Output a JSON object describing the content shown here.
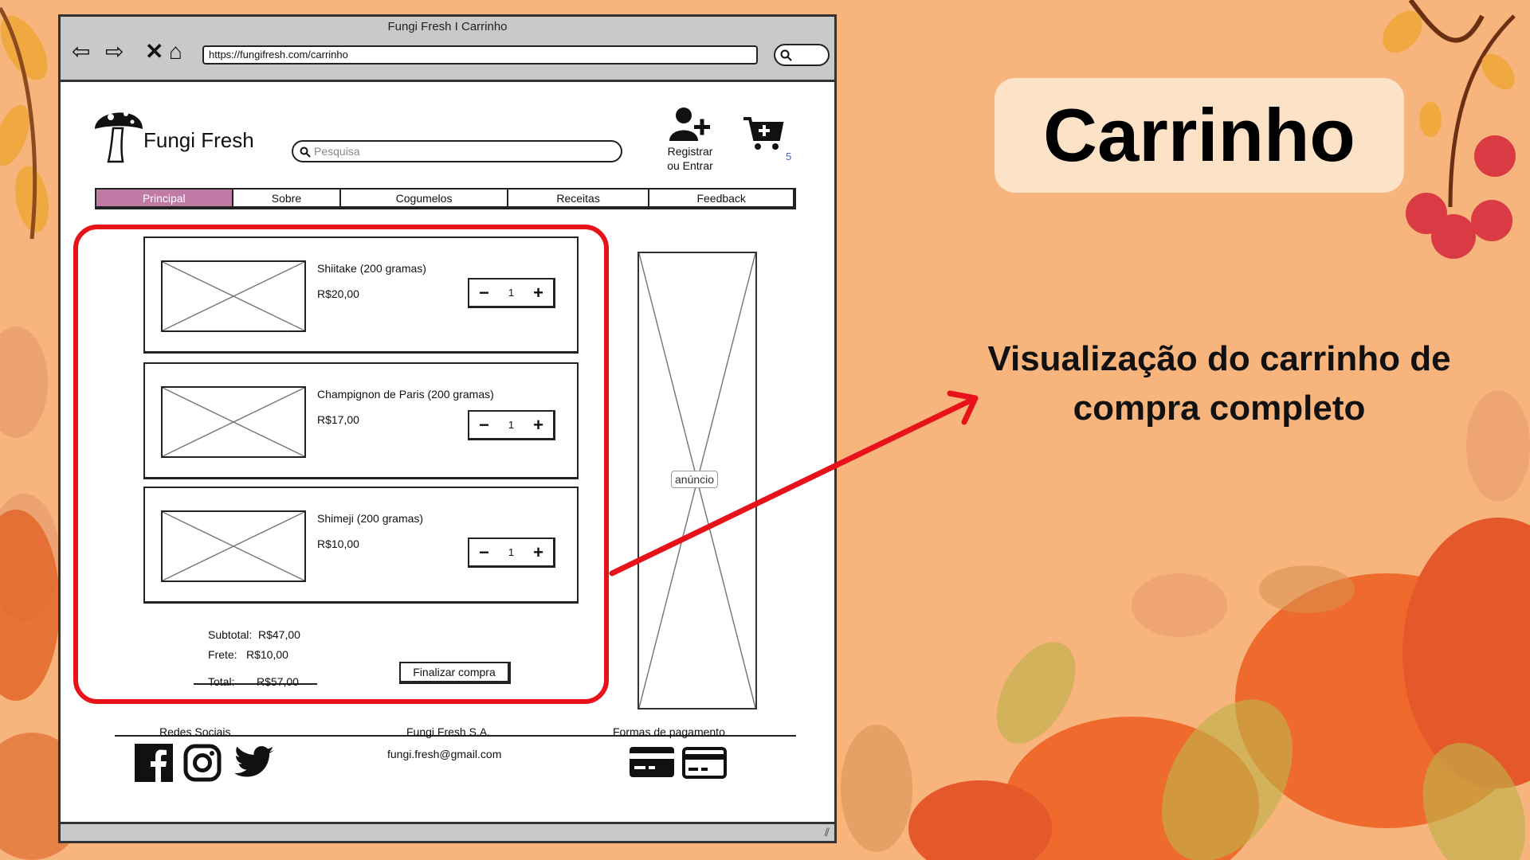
{
  "slide": {
    "title": "Carrinho",
    "description": "Visualização do carrinho de compra completo"
  },
  "browser": {
    "window_title": "Fungi Fresh I Carrinho",
    "url": "https://fungifresh.com/carrinho"
  },
  "header": {
    "brand": "Fungi Fresh",
    "search_placeholder": "Pesquisa",
    "account_label_1": "Registrar",
    "account_label_2": "ou Entrar",
    "cart_count": "5"
  },
  "nav": {
    "tabs": [
      {
        "label": "Principal",
        "active": true
      },
      {
        "label": "Sobre"
      },
      {
        "label": "Cogumelos"
      },
      {
        "label": "Receitas"
      },
      {
        "label": "Feedback"
      }
    ]
  },
  "cart": {
    "items": [
      {
        "name": "Shiitake (200 gramas)",
        "price": "R$20,00",
        "qty": "1"
      },
      {
        "name": "Champignon de Paris (200 gramas)",
        "price": "R$17,00",
        "qty": "1"
      },
      {
        "name": "Shimeji (200 gramas)",
        "price": "R$10,00",
        "qty": "1"
      }
    ],
    "subtotal_label": "Subtotal:",
    "subtotal_value": "R$47,00",
    "shipping_label": "Frete:",
    "shipping_value": "R$10,00",
    "total_label": "Total:",
    "total_value": "R$57,00",
    "checkout_label": "Finalizar compra"
  },
  "ad": {
    "label": "anúncio"
  },
  "footer": {
    "social_title": "Redes Sociais",
    "company": "Fungi Fresh S.A.",
    "email": "fungi.fresh@gmail.com",
    "payment_title": "Formas de pagamento"
  },
  "colors": {
    "background": "#f7b47c",
    "active_tab": "#c07aa6",
    "highlight": "#e8121a",
    "title_card": "#fce3c8"
  }
}
